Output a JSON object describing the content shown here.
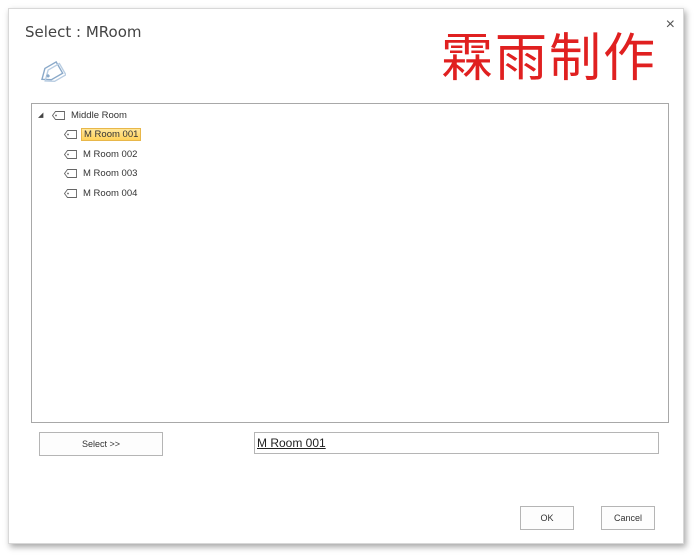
{
  "dialog": {
    "title": "Select : MRoom",
    "close_glyph": "×",
    "watermark": "霖雨制作",
    "header_icon": "tag-icon"
  },
  "tree": {
    "root": {
      "label": "Middle Room",
      "expanded": true,
      "toggle_glyph": "◢"
    },
    "children": [
      {
        "label": "M Room 001",
        "selected": true
      },
      {
        "label": "M Room 002",
        "selected": false
      },
      {
        "label": "M Room 003",
        "selected": false
      },
      {
        "label": "M Room 004",
        "selected": false
      }
    ]
  },
  "selection": {
    "button_label": "Select >>",
    "value": "M Room 001"
  },
  "footer": {
    "ok_label": "OK",
    "cancel_label": "Cancel"
  }
}
